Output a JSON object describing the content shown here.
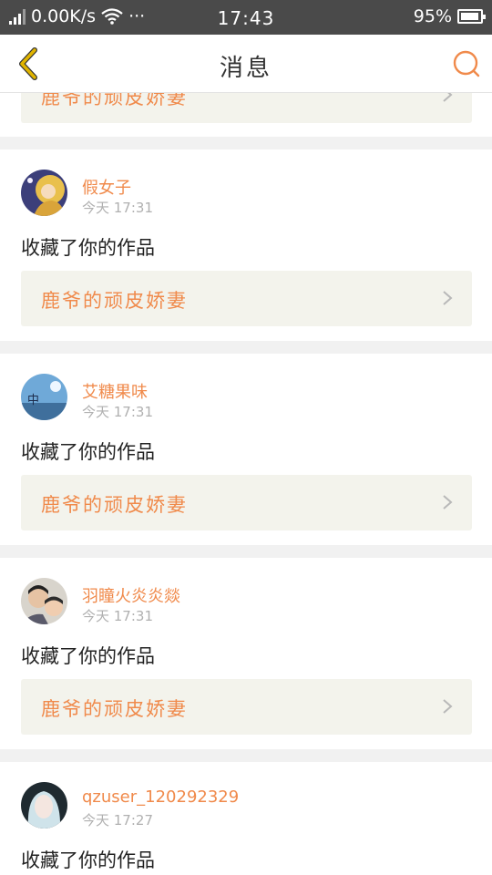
{
  "status_bar": {
    "net_speed": "0.00K/s",
    "dots": "···",
    "time": "17:43",
    "battery_percent": "95%",
    "battery_level": 0.95
  },
  "header": {
    "title": "消息"
  },
  "colors": {
    "accent": "#f08a4b",
    "back_icon": "#e0b400",
    "card_bg": "#ffffff",
    "work_bg": "#f3f3ec",
    "page_bg": "#f1f1f1"
  },
  "messages": [
    {
      "user": "",
      "time": "",
      "action": "",
      "work_title": "鹿爷的顽皮娇妻"
    },
    {
      "user": "假女子",
      "time": "今天 17:31",
      "action": "收藏了你的作品",
      "work_title": "鹿爷的顽皮娇妻"
    },
    {
      "user": "艾糖果味",
      "time": "今天 17:31",
      "action": "收藏了你的作品",
      "work_title": "鹿爷的顽皮娇妻"
    },
    {
      "user": "羽瞳火炎炎燚",
      "time": "今天 17:31",
      "action": "收藏了你的作品",
      "work_title": "鹿爷的顽皮娇妻"
    },
    {
      "user": "qzuser_120292329",
      "time": "今天 17:27",
      "action": "收藏了你的作品",
      "work_title": ""
    }
  ]
}
